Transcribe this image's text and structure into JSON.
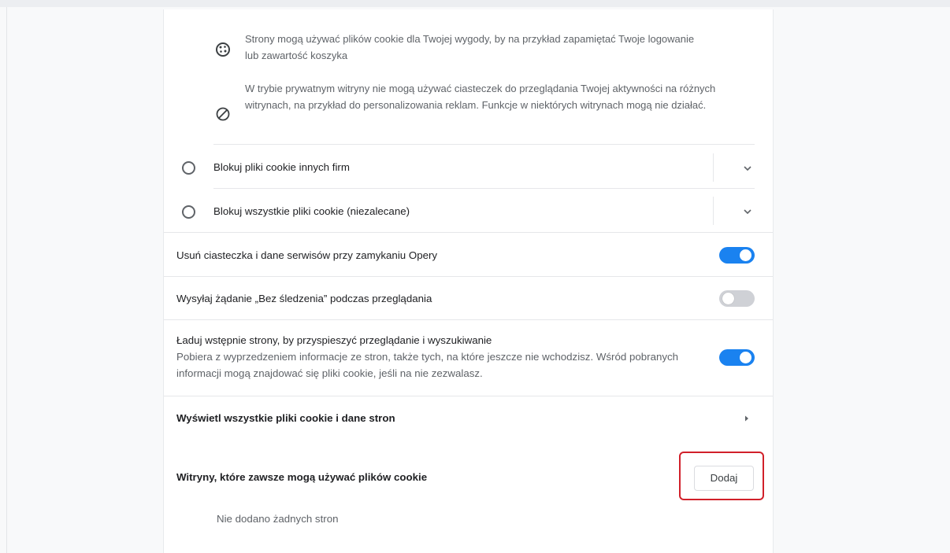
{
  "cookies_info": {
    "item1_text": "Strony mogą używać plików cookie dla Twojej wygody, by na przykład zapamiętać Twoje logowanie lub zawartość koszyka",
    "item1_icon": "cookie-icon",
    "item2_text": "W trybie prywatnym witryny nie mogą używać ciasteczek do przeglądania Twojej aktywności na różnych witrynach, na przykład do personalizowania reklam. Funkcje w niektórych witrynach mogą nie działać.",
    "item2_icon": "block-icon"
  },
  "radio_options": [
    {
      "label": "Blokuj pliki cookie innych firm",
      "selected": false
    },
    {
      "label": "Blokuj wszystkie pliki cookie (niezalecane)",
      "selected": false
    }
  ],
  "toggles": [
    {
      "label": "Usuń ciasteczka i dane serwisów przy zamykaniu Opery",
      "state": "on"
    },
    {
      "label": "Wysyłaj żądanie „Bez śledzenia” podczas przeglądania",
      "state": "off"
    },
    {
      "label": "Ładuj wstępnie strony, by przyspieszyć przeglądanie i wyszukiwanie",
      "sublabel": "Pobiera z wyprzedzeniem informacje ze stron, także tych, na które jeszcze nie wchodzisz. Wśród pobranych informacji mogą znajdować się pliki cookie, jeśli na nie zezwalasz.",
      "state": "on"
    }
  ],
  "view_all": {
    "label": "Wyświetl wszystkie pliki cookie i dane stron"
  },
  "allow_sites": {
    "label": "Witryny, które zawsze mogą używać plików cookie",
    "add_button": "Dodaj",
    "empty_text": "Nie dodano żadnych stron"
  },
  "colors": {
    "accent": "#1a82f0",
    "highlight": "#d1202a"
  }
}
